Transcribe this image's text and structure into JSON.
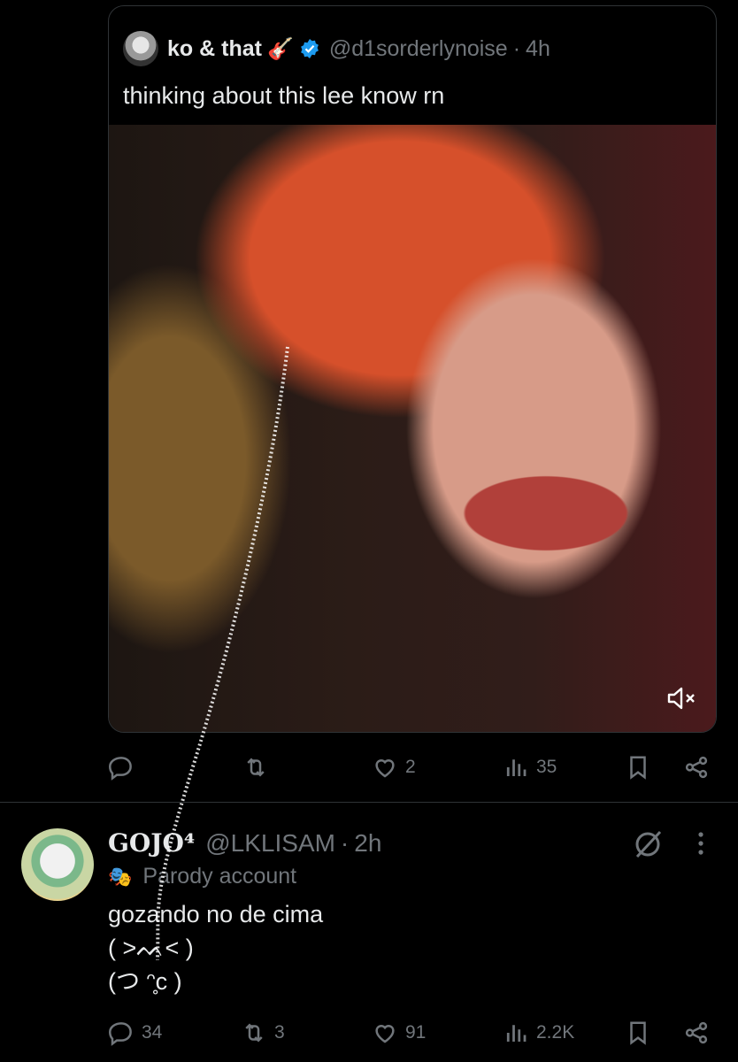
{
  "quote": {
    "name": "ko & that",
    "handle": "@d1sorderlynoise",
    "separator": "·",
    "time": "4h",
    "text": "thinking about this lee know rn",
    "actions": {
      "likes": "2",
      "views": "35"
    }
  },
  "reply": {
    "name": "GOJO⁴",
    "handle": "@LKLISAM",
    "separator": "·",
    "time": "2h",
    "parody_label": "Parody account",
    "text_lines": [
      "gozando no de cima",
      "( ˃ᨓ˂ )",
      "(つ ᵔ̥c )"
    ],
    "actions": {
      "replies": "34",
      "reposts": "3",
      "likes": "91",
      "views": "2.2K"
    }
  },
  "icons": [
    "guitar-icon",
    "verified-icon",
    "mute-icon",
    "reply-icon",
    "repost-icon",
    "like-icon",
    "views-icon",
    "bookmark-icon",
    "share-icon",
    "grok-icon",
    "more-icon",
    "mask-icon"
  ],
  "colors": {
    "background": "#000000",
    "text": "#e7e9ea",
    "muted": "#71767b",
    "verified": "#1d9bf0"
  }
}
